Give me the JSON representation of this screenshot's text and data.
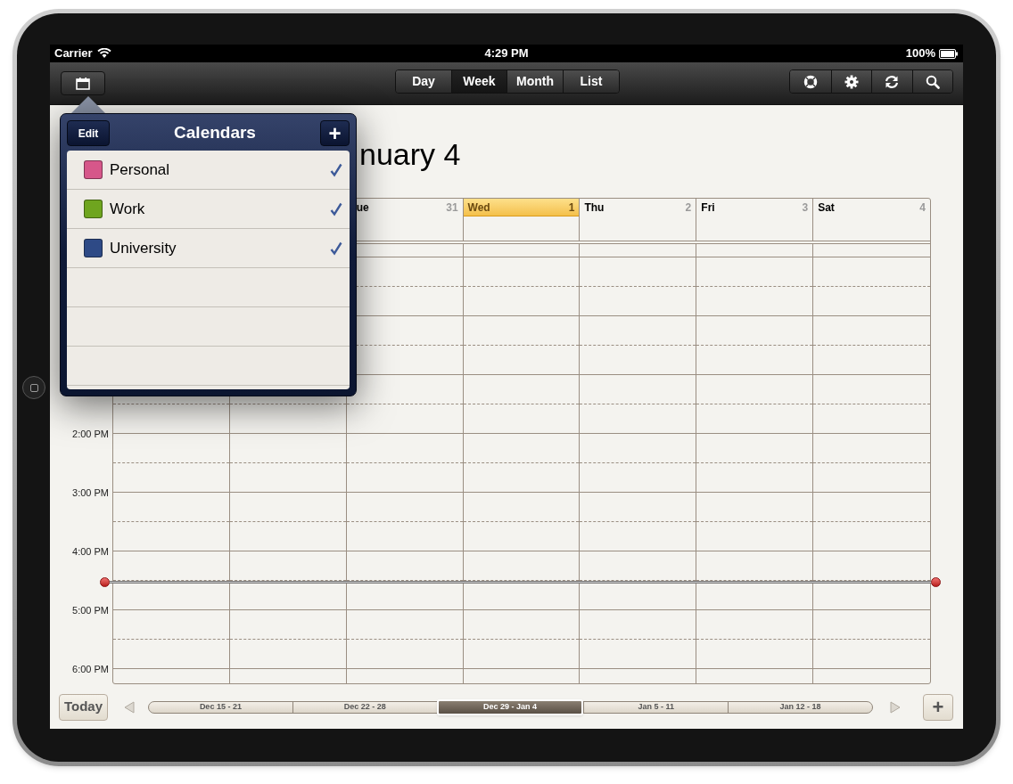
{
  "status_bar": {
    "carrier": "Carrier",
    "time": "4:29 PM",
    "battery": "100%"
  },
  "toolbar": {
    "views": [
      {
        "label": "Day",
        "selected": false
      },
      {
        "label": "Week",
        "selected": true
      },
      {
        "label": "Month",
        "selected": false
      },
      {
        "label": "List",
        "selected": false
      }
    ]
  },
  "week": {
    "title": "nuary 4",
    "days": [
      {
        "name": "ue",
        "date": "31",
        "selected": false
      },
      {
        "name": "Wed",
        "date": "1",
        "selected": true
      },
      {
        "name": "Thu",
        "date": "2",
        "selected": false
      },
      {
        "name": "Fri",
        "date": "3",
        "selected": false
      },
      {
        "name": "Sat",
        "date": "4",
        "selected": false
      }
    ],
    "times": [
      "2:00 PM",
      "3:00 PM",
      "4:00 PM",
      "5:00 PM",
      "6:00 PM"
    ]
  },
  "popover": {
    "edit": "Edit",
    "title": "Calendars",
    "add": "+",
    "calendars": [
      {
        "name": "Personal",
        "color": "#d6578a",
        "checked": true
      },
      {
        "name": "Work",
        "color": "#6fa51f",
        "checked": true
      },
      {
        "name": "University",
        "color": "#2e4a86",
        "checked": true
      }
    ]
  },
  "bottom_bar": {
    "today": "Today",
    "add": "+",
    "weeks": [
      {
        "label": "Dec 15 - 21",
        "selected": false
      },
      {
        "label": "Dec 22 - 28",
        "selected": false
      },
      {
        "label": "Dec 29 - Jan 4",
        "selected": true
      },
      {
        "label": "Jan 5 - 11",
        "selected": false
      },
      {
        "label": "Jan 12 - 18",
        "selected": false
      }
    ]
  }
}
